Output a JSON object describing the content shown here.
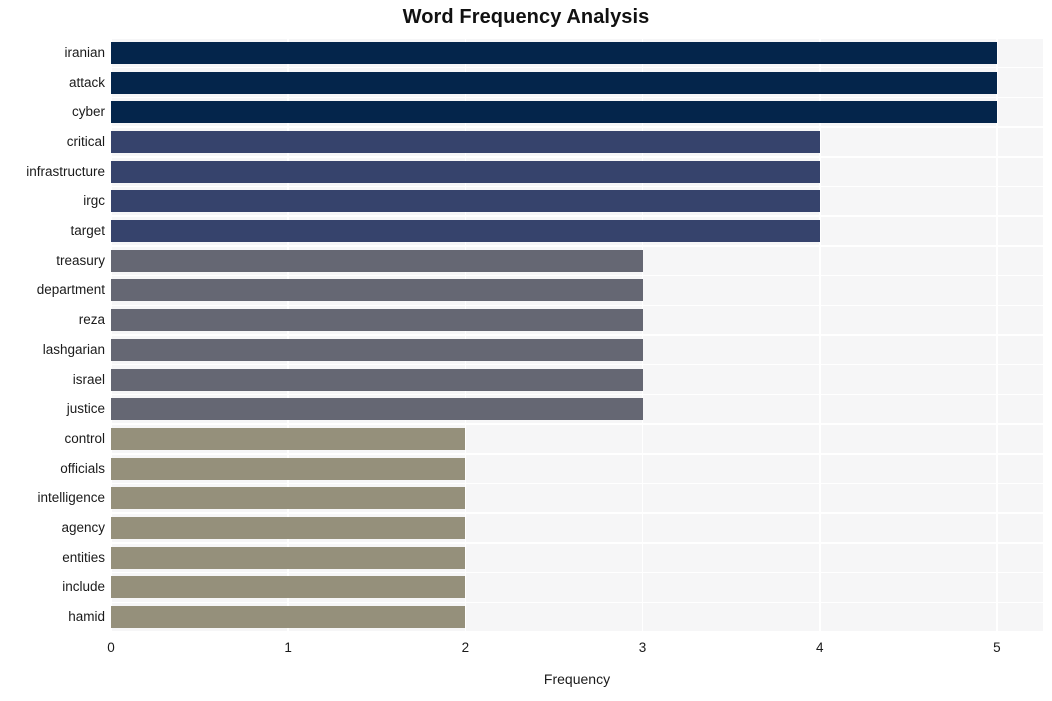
{
  "chart_data": {
    "type": "bar",
    "orientation": "horizontal",
    "title": "Word Frequency Analysis",
    "xlabel": "Frequency",
    "ylabel": "",
    "xlim": [
      0,
      5.26
    ],
    "xticks": [
      0,
      1,
      2,
      3,
      4,
      5
    ],
    "xtick_labels": [
      "0",
      "1",
      "2",
      "3",
      "4",
      "5"
    ],
    "grid": true,
    "legend": null,
    "categories": [
      "iranian",
      "attack",
      "cyber",
      "critical",
      "infrastructure",
      "irgc",
      "target",
      "treasury",
      "department",
      "reza",
      "lashgarian",
      "israel",
      "justice",
      "control",
      "officials",
      "intelligence",
      "agency",
      "entities",
      "include",
      "hamid"
    ],
    "values": [
      5,
      5,
      5,
      4,
      4,
      4,
      4,
      3,
      3,
      3,
      3,
      3,
      3,
      2,
      2,
      2,
      2,
      2,
      2,
      2
    ],
    "bar_colors": [
      "#04254b",
      "#04254b",
      "#04254b",
      "#36436c",
      "#36436c",
      "#36436c",
      "#36436c",
      "#656773",
      "#656773",
      "#656773",
      "#656773",
      "#656773",
      "#656773",
      "#95907b",
      "#95907b",
      "#95907b",
      "#95907b",
      "#95907b",
      "#95907b",
      "#95907b"
    ]
  },
  "style": {
    "plot_background": "#f6f6f7",
    "grid_color": "#ffffff",
    "page_background": "#ffffff",
    "text_color": "#1a1a1a",
    "title_color": "#111111"
  }
}
